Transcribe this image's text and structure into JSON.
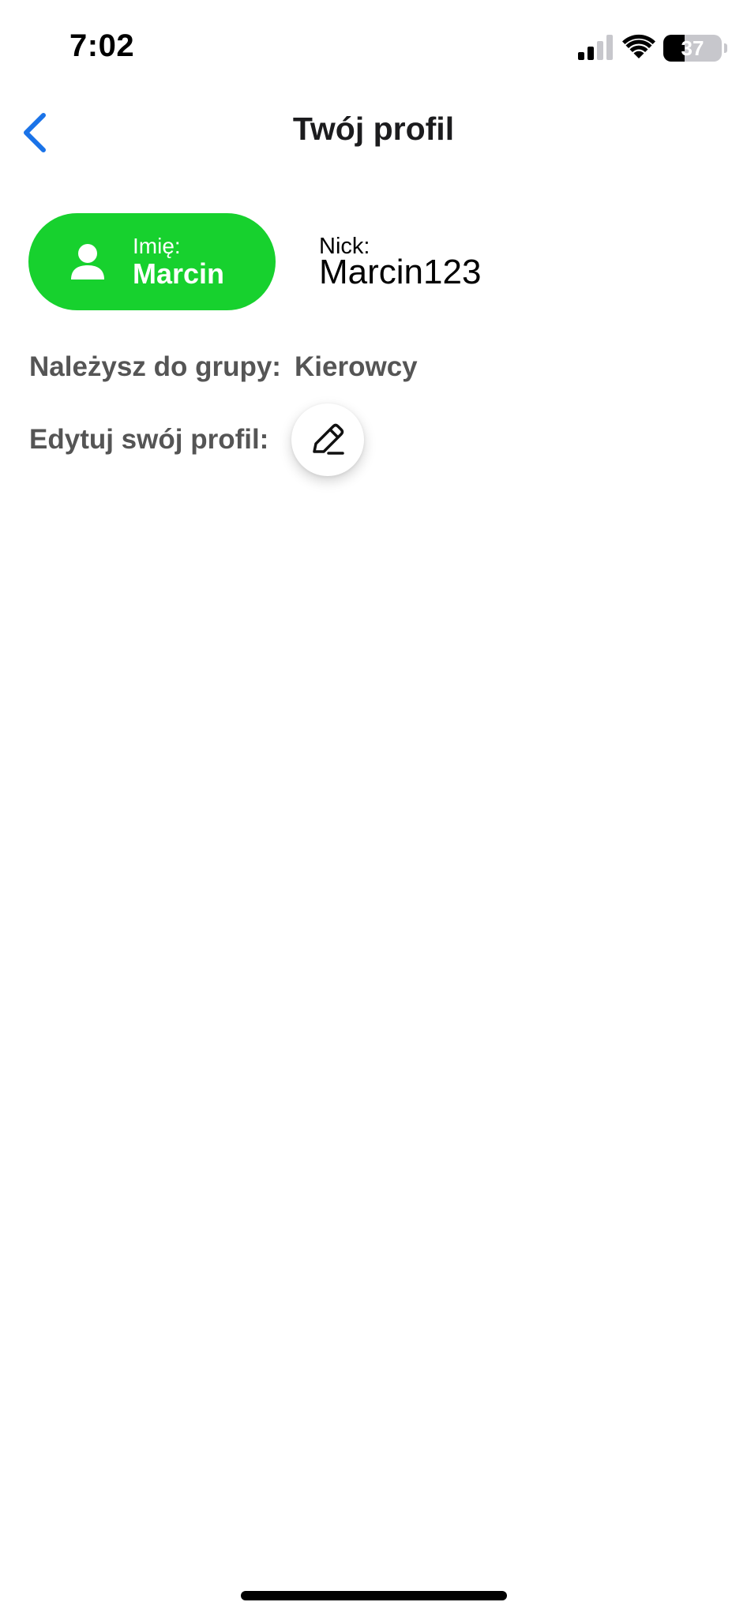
{
  "status_bar": {
    "time": "7:02",
    "battery_level": "37",
    "battery_fraction": 0.37,
    "icons": [
      "signal-icon",
      "wifi-icon",
      "battery-icon"
    ]
  },
  "nav": {
    "back_icon": "chevron-left-icon",
    "title": "Twój profil"
  },
  "profile": {
    "name_label": "Imię:",
    "name": "Marcin",
    "nick_label": "Nick:",
    "nick": "Marcin123",
    "group_label": "Należysz do grupy:",
    "group": "Kierowcy",
    "edit_label": "Edytuj swój profil:",
    "edit_icon": "pencil-icon",
    "person_icon": "person-icon"
  },
  "colors": {
    "accent": "#17d12e",
    "link": "#1a73e8",
    "label_gray": "#555555"
  }
}
